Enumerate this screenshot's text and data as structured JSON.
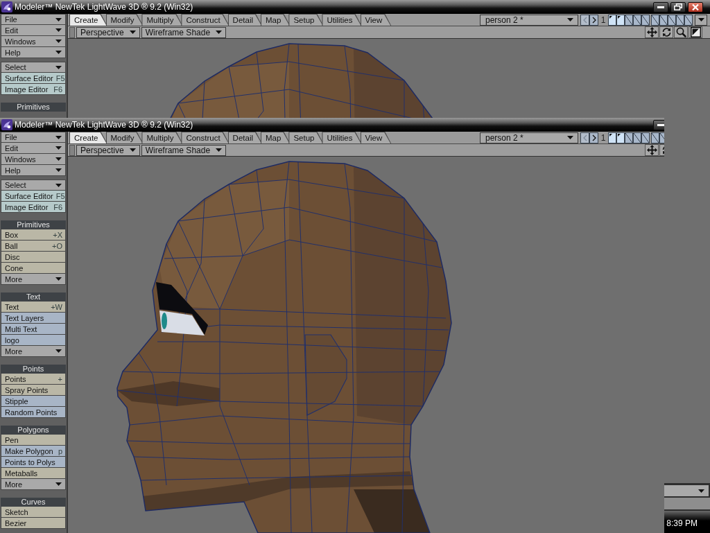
{
  "back_window": {
    "title": "Modeler™ NewTek LightWave 3D ® 9.2 (Win32)",
    "title_buttons": [
      {
        "kind": "minimize"
      },
      {
        "kind": "restore"
      },
      {
        "kind": "close"
      }
    ],
    "sidebar": [
      {
        "items": [
          {
            "kind": "menu",
            "label": "File",
            "color": "#a9a9a9"
          },
          {
            "kind": "menu",
            "label": "Edit",
            "color": "#a9a9a9"
          },
          {
            "kind": "menu",
            "label": "Windows",
            "color": "#a9a9a9"
          },
          {
            "kind": "menu",
            "label": "Help",
            "color": "#a9a9a9"
          }
        ]
      },
      {
        "items": [
          {
            "kind": "menu",
            "label": "Select",
            "color": "#a9a9a9"
          },
          {
            "kind": "command",
            "label": "Surface Editor",
            "shortcut": "F5",
            "color": "#b6caca"
          },
          {
            "kind": "command",
            "label": "Image Editor",
            "shortcut": "F6",
            "color": "#b6caca"
          }
        ]
      },
      {
        "header": "Primitives"
      }
    ],
    "tabs": [
      {
        "label": "Create",
        "selected": true
      },
      {
        "label": "Modify",
        "selected": false
      },
      {
        "label": "Multiply",
        "selected": false
      },
      {
        "label": "Construct",
        "selected": false
      },
      {
        "label": "Detail",
        "selected": false
      },
      {
        "label": "Map",
        "selected": false
      },
      {
        "label": "Setup",
        "selected": false
      },
      {
        "label": "Utilities",
        "selected": false
      },
      {
        "label": "View",
        "selected": false
      }
    ],
    "object_menu": {
      "value": "person 2 *"
    },
    "layer_nav": [
      {
        "kind": "previous",
        "disabled": true
      },
      {
        "kind": "next",
        "disabled": false
      }
    ],
    "layer_bank": "1",
    "layers": [
      {
        "selected": true,
        "has_data": true
      },
      {
        "selected": true,
        "has_data": true
      },
      {
        "selected": false,
        "has_data": false
      },
      {
        "selected": false,
        "has_data": false
      },
      {
        "selected": false,
        "has_data": false
      },
      {
        "selected": false,
        "has_data": false
      },
      {
        "selected": false,
        "has_data": false
      },
      {
        "selected": false,
        "has_data": false
      },
      {
        "selected": false,
        "has_data": false
      },
      {
        "selected": false,
        "has_data": false
      }
    ],
    "layer_menu": true,
    "view_menus": [
      "Perspective",
      "Wireframe Shade"
    ],
    "view_tools": [
      {
        "kind": "move"
      },
      {
        "kind": "rotate"
      },
      {
        "kind": "zoom"
      },
      {
        "kind": "maximize"
      }
    ],
    "bottom_bar": {
      "controls": [
        {
          "kind": "dropdown"
        }
      ]
    }
  },
  "front_window": {
    "title": "Modeler™ NewTek LightWave 3D ® 9.2 (Win32)",
    "title_buttons": [
      {
        "kind": "minimize"
      }
    ],
    "sidebar": [
      {
        "items": [
          {
            "kind": "menu",
            "label": "File",
            "color": "#a9a9a9"
          },
          {
            "kind": "menu",
            "label": "Edit",
            "color": "#a9a9a9"
          },
          {
            "kind": "menu",
            "label": "Windows",
            "color": "#a9a9a9"
          },
          {
            "kind": "menu",
            "label": "Help",
            "color": "#a9a9a9"
          }
        ]
      },
      {
        "items": [
          {
            "kind": "menu",
            "label": "Select",
            "color": "#a9a9a9"
          },
          {
            "kind": "command",
            "label": "Surface Editor",
            "shortcut": "F5",
            "color": "#b6caca"
          },
          {
            "kind": "command",
            "label": "Image Editor",
            "shortcut": "F6",
            "color": "#b6caca"
          }
        ]
      },
      {
        "header": "Primitives",
        "items": [
          {
            "kind": "command",
            "label": "Box",
            "shortcut": "+X",
            "color": "#bab7a6"
          },
          {
            "kind": "command",
            "label": "Ball",
            "shortcut": "+O",
            "color": "#bab7a6"
          },
          {
            "kind": "command",
            "label": "Disc",
            "color": "#bab7a6"
          },
          {
            "kind": "command",
            "label": "Cone",
            "color": "#bab7a6"
          },
          {
            "kind": "menu",
            "label": "More",
            "color": "#a9a9a9"
          }
        ]
      },
      {
        "header": "Text",
        "items": [
          {
            "kind": "command",
            "label": "Text",
            "shortcut": "+W",
            "color": "#bab7a6"
          },
          {
            "kind": "command",
            "label": "Text Layers",
            "color": "#a8b5c6"
          },
          {
            "kind": "command",
            "label": "Multi Text",
            "color": "#a8b5c6"
          },
          {
            "kind": "command",
            "label": "logo",
            "color": "#a8b5c6"
          },
          {
            "kind": "menu",
            "label": "More",
            "color": "#a9a9a9"
          }
        ]
      },
      {
        "header": "Points",
        "items": [
          {
            "kind": "command",
            "label": "Points",
            "shortcut": "+",
            "color": "#bab7a6"
          },
          {
            "kind": "command",
            "label": "Spray Points",
            "color": "#bab7a6"
          },
          {
            "kind": "command",
            "label": "Stipple",
            "color": "#a8b5c6"
          },
          {
            "kind": "command",
            "label": "Random Points",
            "color": "#a8b5c6"
          }
        ]
      },
      {
        "header": "Polygons",
        "items": [
          {
            "kind": "command",
            "label": "Pen",
            "color": "#bab7a6"
          },
          {
            "kind": "command",
            "label": "Make Polygon",
            "shortcut": "p",
            "color": "#a8b5c6"
          },
          {
            "kind": "command",
            "label": "Points to Polys",
            "color": "#a8b5c6"
          },
          {
            "kind": "command",
            "label": "Metaballs",
            "color": "#bab7a6"
          },
          {
            "kind": "menu",
            "label": "More",
            "color": "#a9a9a9"
          }
        ]
      },
      {
        "header": "Curves",
        "items": [
          {
            "kind": "command",
            "label": "Sketch",
            "color": "#bab7a6"
          },
          {
            "kind": "command",
            "label": "Bezier",
            "color": "#bab7a6"
          }
        ]
      }
    ],
    "tabs": [
      {
        "label": "Create",
        "selected": true
      },
      {
        "label": "Modify",
        "selected": false
      },
      {
        "label": "Multiply",
        "selected": false
      },
      {
        "label": "Construct",
        "selected": false
      },
      {
        "label": "Detail",
        "selected": false
      },
      {
        "label": "Map",
        "selected": false
      },
      {
        "label": "Setup",
        "selected": false
      },
      {
        "label": "Utilities",
        "selected": false
      },
      {
        "label": "View",
        "selected": false
      }
    ],
    "object_menu": {
      "value": "person 2 *"
    },
    "layer_nav": [
      {
        "kind": "previous",
        "disabled": true
      },
      {
        "kind": "next",
        "disabled": false
      }
    ],
    "layer_bank": "1",
    "layers": [
      {
        "selected": true,
        "has_data": true
      },
      {
        "selected": true,
        "has_data": true
      },
      {
        "selected": false,
        "has_data": false
      },
      {
        "selected": false,
        "has_data": false
      },
      {
        "selected": false,
        "has_data": false
      },
      {
        "selected": false,
        "has_data": false
      },
      {
        "selected": false,
        "has_data": false
      }
    ],
    "view_menus": [
      "Perspective",
      "Wireframe Shade"
    ],
    "view_tools": [
      {
        "kind": "move"
      },
      {
        "kind": "rotate"
      }
    ]
  },
  "taskbar": {
    "clock": "8:39 PM"
  }
}
